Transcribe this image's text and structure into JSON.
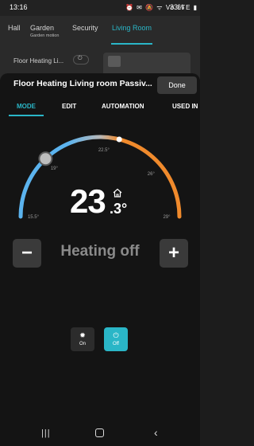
{
  "status_bar": {
    "time": "13:16",
    "icons": "⏰ ✉ 🔕 ᯤ Vo LTE ▮",
    "battery": "33%"
  },
  "background": {
    "tabs": [
      {
        "label": "Hall"
      },
      {
        "label": "Garden",
        "sub": "Garden motion"
      },
      {
        "label": "Security"
      },
      {
        "label": "Living Room"
      }
    ],
    "row_label": "Floor Heating Li..."
  },
  "sheet": {
    "title": "Floor Heating Living room Passiv...",
    "done_label": "Done",
    "tabs": [
      "MODE",
      "EDIT",
      "AUTOMATION",
      "USED IN"
    ]
  },
  "thermostat": {
    "current_temp_int": "23",
    "current_temp_dec": ".3°",
    "setpoint": 19,
    "scale_min": 15.5,
    "scale_max": 29,
    "tick_labels": [
      {
        "value": 15.5,
        "text": "15.5°"
      },
      {
        "value": 19,
        "text": "19°"
      },
      {
        "value": 22.5,
        "text": "22.5°"
      },
      {
        "value": 26,
        "text": "26°"
      },
      {
        "value": 29,
        "text": "29°"
      }
    ],
    "status_label": "Heating off",
    "minus_label": "−",
    "plus_label": "+",
    "colors": {
      "cold": "#5bb3ee",
      "warm": "#f08a2c",
      "mid": "#b8b8b8"
    }
  },
  "mode_buttons": {
    "on_label": "On",
    "off_label": "Off",
    "on_icon": "sun-icon",
    "off_icon": "power-icon"
  }
}
